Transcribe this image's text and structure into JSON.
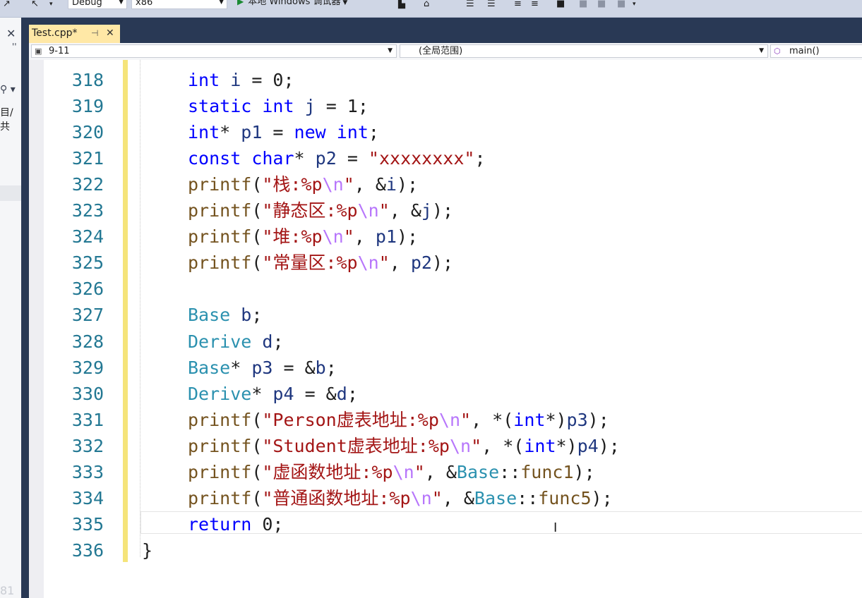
{
  "toolbar": {
    "config": "Debug",
    "platform": "x86",
    "run_label": "本地 Windows 调试器"
  },
  "tab": {
    "label": "Test.cpp*"
  },
  "nav": {
    "project_scope": "9-11",
    "global_scope": "(全局范围)",
    "function": "main()"
  },
  "left_strip": {
    "line_partial": "81"
  },
  "editor": {
    "lines": [
      {
        "num": "318",
        "tokens": [
          [
            "kw",
            "int"
          ],
          [
            "p",
            " "
          ],
          [
            "var",
            "i"
          ],
          [
            "p",
            " = 0;"
          ]
        ]
      },
      {
        "num": "319",
        "tokens": [
          [
            "kw",
            "static"
          ],
          [
            "p",
            " "
          ],
          [
            "kw",
            "int"
          ],
          [
            "p",
            " "
          ],
          [
            "var",
            "j"
          ],
          [
            "p",
            " = 1;"
          ]
        ]
      },
      {
        "num": "320",
        "tokens": [
          [
            "kw",
            "int"
          ],
          [
            "p",
            "* "
          ],
          [
            "var",
            "p1"
          ],
          [
            "p",
            " = "
          ],
          [
            "kw",
            "new"
          ],
          [
            "p",
            " "
          ],
          [
            "kw",
            "int"
          ],
          [
            "p",
            ";"
          ]
        ]
      },
      {
        "num": "321",
        "tokens": [
          [
            "kw",
            "const"
          ],
          [
            "p",
            " "
          ],
          [
            "kw",
            "char"
          ],
          [
            "p",
            "* "
          ],
          [
            "var",
            "p2"
          ],
          [
            "p",
            " = "
          ],
          [
            "str",
            "\"xxxxxxxx\""
          ],
          [
            "p",
            ";"
          ]
        ]
      },
      {
        "num": "322",
        "tokens": [
          [
            "fn",
            "printf"
          ],
          [
            "p",
            "("
          ],
          [
            "str",
            "\"栈:%p"
          ],
          [
            "esc",
            "\\n"
          ],
          [
            "str",
            "\""
          ],
          [
            "p",
            ", &"
          ],
          [
            "var",
            "i"
          ],
          [
            "p",
            ");"
          ]
        ]
      },
      {
        "num": "323",
        "tokens": [
          [
            "fn",
            "printf"
          ],
          [
            "p",
            "("
          ],
          [
            "str",
            "\"静态区:%p"
          ],
          [
            "esc",
            "\\n"
          ],
          [
            "str",
            "\""
          ],
          [
            "p",
            ", &"
          ],
          [
            "var",
            "j"
          ],
          [
            "p",
            ");"
          ]
        ]
      },
      {
        "num": "324",
        "tokens": [
          [
            "fn",
            "printf"
          ],
          [
            "p",
            "("
          ],
          [
            "str",
            "\"堆:%p"
          ],
          [
            "esc",
            "\\n"
          ],
          [
            "str",
            "\""
          ],
          [
            "p",
            ", "
          ],
          [
            "var",
            "p1"
          ],
          [
            "p",
            ");"
          ]
        ]
      },
      {
        "num": "325",
        "tokens": [
          [
            "fn",
            "printf"
          ],
          [
            "p",
            "("
          ],
          [
            "str",
            "\"常量区:%p"
          ],
          [
            "esc",
            "\\n"
          ],
          [
            "str",
            "\""
          ],
          [
            "p",
            ", "
          ],
          [
            "var",
            "p2"
          ],
          [
            "p",
            ");"
          ]
        ]
      },
      {
        "num": "326",
        "tokens": []
      },
      {
        "num": "327",
        "tokens": [
          [
            "ty",
            "Base"
          ],
          [
            "p",
            " "
          ],
          [
            "var",
            "b"
          ],
          [
            "p",
            ";"
          ]
        ]
      },
      {
        "num": "328",
        "tokens": [
          [
            "ty",
            "Derive"
          ],
          [
            "p",
            " "
          ],
          [
            "var",
            "d"
          ],
          [
            "p",
            ";"
          ]
        ]
      },
      {
        "num": "329",
        "tokens": [
          [
            "ty",
            "Base"
          ],
          [
            "p",
            "* "
          ],
          [
            "var",
            "p3"
          ],
          [
            "p",
            " = &"
          ],
          [
            "var",
            "b"
          ],
          [
            "p",
            ";"
          ]
        ]
      },
      {
        "num": "330",
        "tokens": [
          [
            "ty",
            "Derive"
          ],
          [
            "p",
            "* "
          ],
          [
            "var",
            "p4"
          ],
          [
            "p",
            " = &"
          ],
          [
            "var",
            "d"
          ],
          [
            "p",
            ";"
          ]
        ]
      },
      {
        "num": "331",
        "tokens": [
          [
            "fn",
            "printf"
          ],
          [
            "p",
            "("
          ],
          [
            "str",
            "\"Person虚表地址:%p"
          ],
          [
            "esc",
            "\\n"
          ],
          [
            "str",
            "\""
          ],
          [
            "p",
            ", *("
          ],
          [
            "kw",
            "int"
          ],
          [
            "p",
            "*)"
          ],
          [
            "var",
            "p3"
          ],
          [
            "p",
            ");"
          ]
        ]
      },
      {
        "num": "332",
        "tokens": [
          [
            "fn",
            "printf"
          ],
          [
            "p",
            "("
          ],
          [
            "str",
            "\"Student虚表地址:%p"
          ],
          [
            "esc",
            "\\n"
          ],
          [
            "str",
            "\""
          ],
          [
            "p",
            ", *("
          ],
          [
            "kw",
            "int"
          ],
          [
            "p",
            "*)"
          ],
          [
            "var",
            "p4"
          ],
          [
            "p",
            ");"
          ]
        ]
      },
      {
        "num": "333",
        "tokens": [
          [
            "fn",
            "printf"
          ],
          [
            "p",
            "("
          ],
          [
            "str",
            "\"虚函数地址:%p"
          ],
          [
            "esc",
            "\\n"
          ],
          [
            "str",
            "\""
          ],
          [
            "p",
            ", &"
          ],
          [
            "ty",
            "Base"
          ],
          [
            "p",
            "::"
          ],
          [
            "fn",
            "func1"
          ],
          [
            "p",
            ");"
          ]
        ]
      },
      {
        "num": "334",
        "tokens": [
          [
            "fn",
            "printf"
          ],
          [
            "p",
            "("
          ],
          [
            "str",
            "\"普通函数地址:%p"
          ],
          [
            "esc",
            "\\n"
          ],
          [
            "str",
            "\""
          ],
          [
            "p",
            ", &"
          ],
          [
            "ty",
            "Base"
          ],
          [
            "p",
            "::"
          ],
          [
            "fn",
            "func5"
          ],
          [
            "p",
            ");"
          ]
        ]
      },
      {
        "num": "335",
        "tokens": [
          [
            "kw",
            "return"
          ],
          [
            "p",
            " 0;"
          ]
        ]
      },
      {
        "num": "336",
        "tokens": []
      }
    ],
    "closing_brace": "}"
  }
}
